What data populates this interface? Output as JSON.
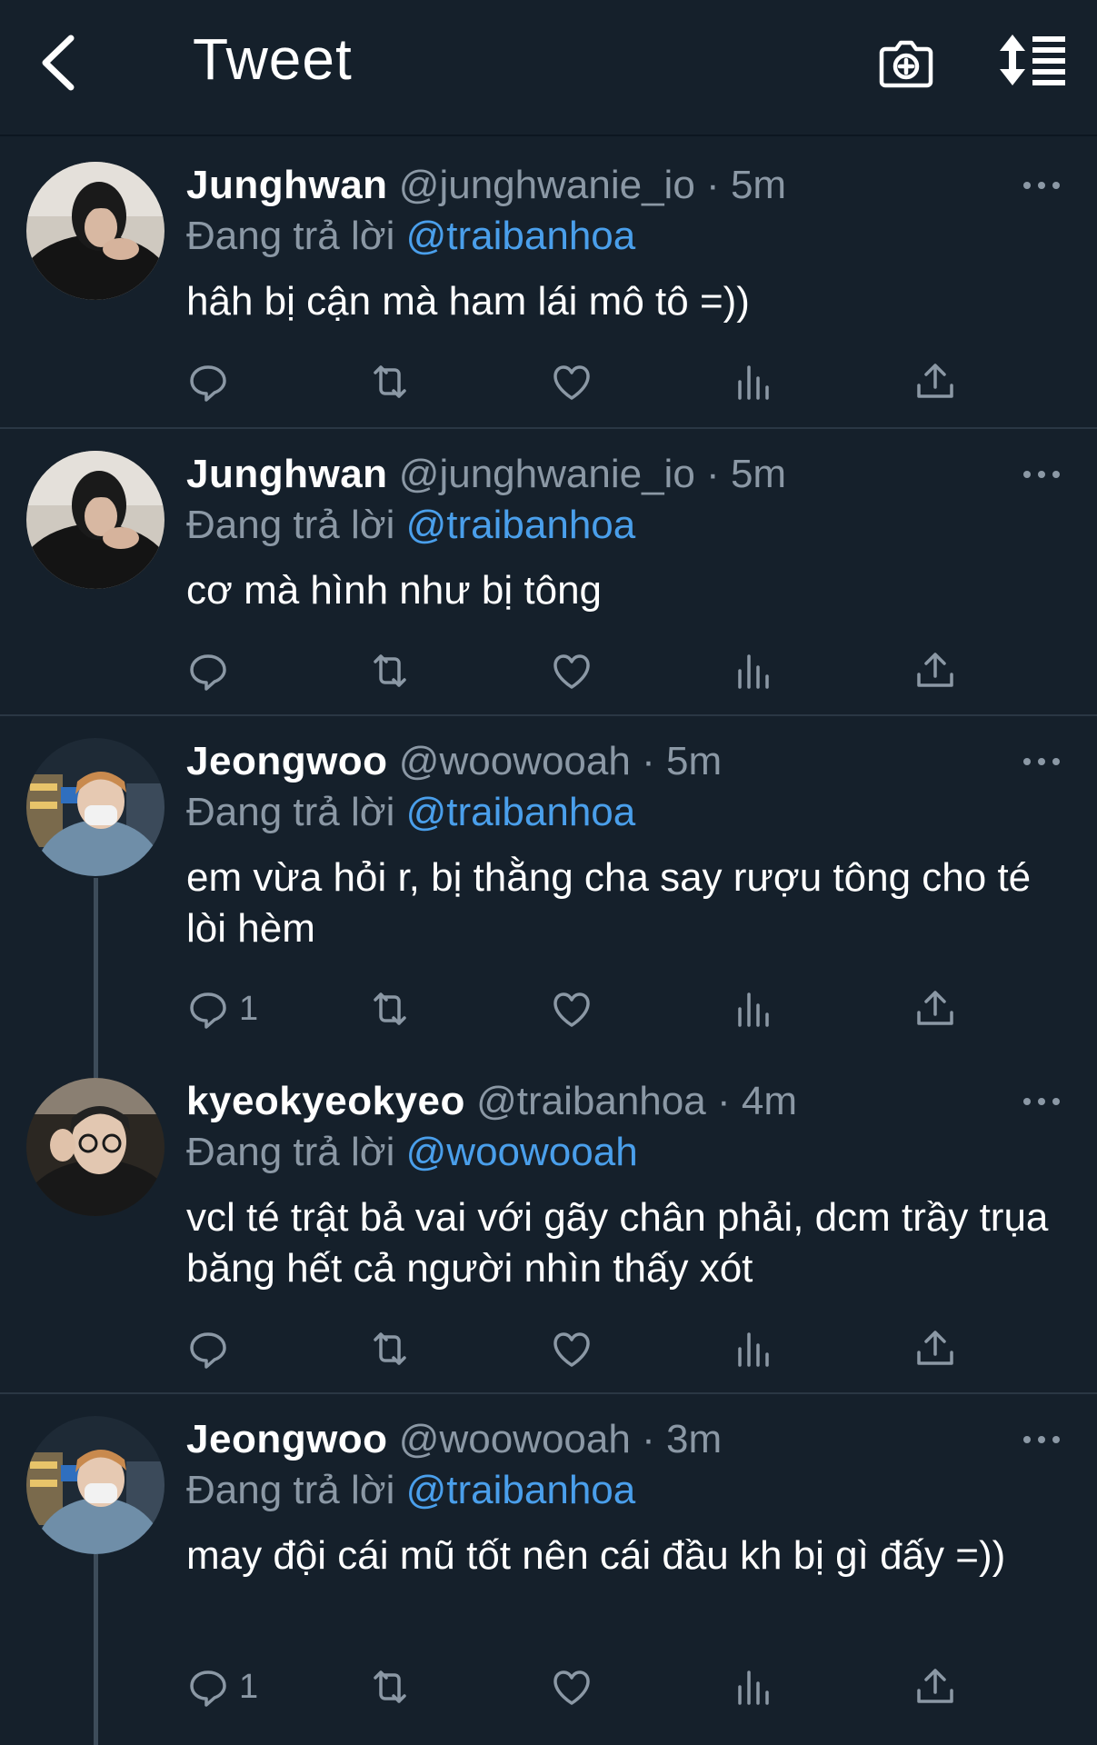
{
  "header": {
    "title": "Tweet",
    "back_icon": "back-arrow-icon",
    "camera_icon": "camera-add-icon",
    "sort_icon": "sort-icon"
  },
  "colors": {
    "background": "#15202b",
    "link": "#4a9feb",
    "secondary_text": "#8b98a5"
  },
  "tweets": [
    {
      "name": "Junghwan",
      "handle": "@junghwanie_io",
      "dot": "·",
      "time": "5m",
      "reply_prefix": "Đang trả lời",
      "reply_to": "@traibanhoa",
      "text": "hâh bị cận mà ham lái mô tô =))",
      "reply_count": "",
      "avatar": "avatar-junghwan"
    },
    {
      "name": "Junghwan",
      "handle": "@junghwanie_io",
      "dot": "·",
      "time": "5m",
      "reply_prefix": "Đang trả lời",
      "reply_to": "@traibanhoa",
      "text": "cơ mà hình như bị tông",
      "reply_count": "",
      "avatar": "avatar-junghwan"
    },
    {
      "name": "Jeongwoo",
      "handle": "@woowooah",
      "dot": "·",
      "time": "5m",
      "reply_prefix": "Đang trả lời",
      "reply_to": "@traibanhoa",
      "text": "em vừa hỏi r, bị thằng cha say rượu tông cho té lòi hèm",
      "reply_count": "1",
      "avatar": "avatar-jeongwoo"
    },
    {
      "name": "kyeokyeokyeo",
      "handle": "@traibanhoa",
      "dot": "·",
      "time": "4m",
      "reply_prefix": "Đang trả lời",
      "reply_to": "@woowooah",
      "text": "vcl té trật bả vai với gãy chân phải, dcm trầy trụa băng hết cả người nhìn thấy xót",
      "reply_count": "",
      "avatar": "avatar-kyeokyeokyeo"
    },
    {
      "name": "Jeongwoo",
      "handle": "@woowooah",
      "dot": "·",
      "time": "3m",
      "reply_prefix": "Đang trả lời",
      "reply_to": "@traibanhoa",
      "text": "may đội cái mũ tốt nên cái đầu kh bị gì đấy =))",
      "reply_count": "1",
      "avatar": "avatar-jeongwoo"
    }
  ]
}
